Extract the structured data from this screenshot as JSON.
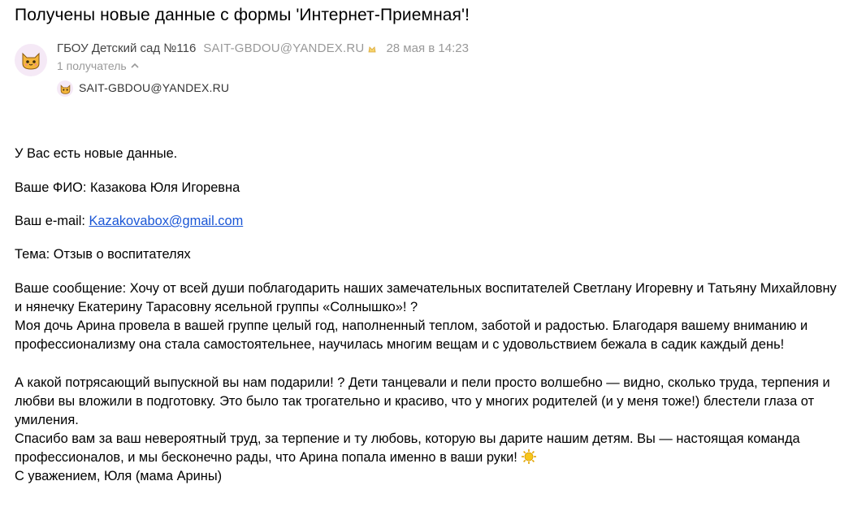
{
  "email": {
    "subject": "Получены новые данные с формы 'Интернет-Приемная'!",
    "sender_name": "ГБОУ Детский сад №116",
    "sender_email": "SAIT-GBDOU@YANDEX.RU",
    "date": "28 мая в 14:23",
    "recipients_toggle": "1 получатель",
    "recipient_email": "SAIT-GBDOU@YANDEX.RU"
  },
  "body": {
    "intro": "У Вас есть новые данные.",
    "fio_label": "Ваше ФИО: ",
    "fio_value": "Казакова Юля Игоревна",
    "email_label": "Ваш e-mail: ",
    "email_value": "Kazakovabox@gmail.com",
    "topic_label": "Тема: ",
    "topic_value": "Отзыв о воспитателях",
    "message_label": "Ваше сообщение: ",
    "message_line1": "Хочу от всей души поблагодарить наших замечательных воспитателей Светлану Игоревну и Татьяну Михайловну и нянечку Екатерину Тарасовну ясельной группы «Солнышко»! ?",
    "message_para2": "Моя дочь Арина провела в вашей группе целый год, наполненный теплом, заботой и радостью. Благодаря вашему вниманию и профессионализму она стала самостоятельнее, научилась многим вещам и с удовольствием бежала в садик каждый день!",
    "message_para3": "А какой потрясающий выпускной вы нам подарили! ? Дети танцевали и пели просто волшебно — видно, сколько труда, терпения и любви вы вложили в подготовку. Это было так трогательно и красиво, что у многих родителей (и у меня тоже!) блестели глаза от умиления.",
    "message_para4": "Спасибо вам за ваш невероятный труд, за терпение и ту любовь, которую вы дарите нашим детям. Вы — настоящая команда профессионалов, и мы бесконечно рады, что Арина попала именно в ваши руки!",
    "signature": "С уважением, Юля (мама Арины)"
  },
  "icons": {
    "avatar": "cat-avatar-icon",
    "verified": "verified-sender-icon",
    "chevron": "chevron-up-icon",
    "sun": "sun-emoji-icon"
  },
  "colors": {
    "link": "#1a56d6",
    "muted": "#999999",
    "avatar_bg": "#f5e9f6"
  }
}
